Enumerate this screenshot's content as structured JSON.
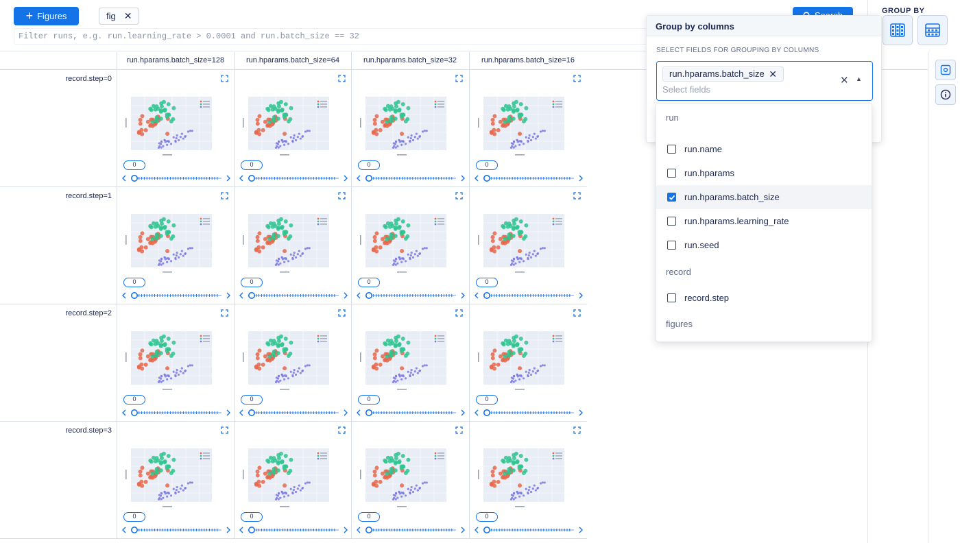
{
  "toolbar": {
    "figures_button": "Figures",
    "explore_chip": "fig",
    "search_button": "Search",
    "filter_placeholder": "Filter runs, e.g. run.learning_rate > 0.0001 and run.batch_size == 32"
  },
  "group_by": {
    "label": "GROUP BY"
  },
  "grid": {
    "columns": [
      "run.hparams.batch_size=128",
      "run.hparams.batch_size=64",
      "run.hparams.batch_size=32",
      "run.hparams.batch_size=16"
    ],
    "rows": [
      "record.step=0",
      "record.step=1",
      "record.step=2",
      "record.step=3"
    ],
    "step_value": "0"
  },
  "popup": {
    "title": "Group by columns",
    "subtitle": "SELECT FIELDS FOR GROUPING BY COLUMNS",
    "selected_chip": "run.hparams.batch_size",
    "placeholder": "Select fields",
    "groups": [
      {
        "name": "run",
        "items": [
          {
            "label": "run.name",
            "checked": false
          },
          {
            "label": "run.hparams",
            "checked": false
          },
          {
            "label": "run.hparams.batch_size",
            "checked": true
          },
          {
            "label": "run.hparams.learning_rate",
            "checked": false
          },
          {
            "label": "run.seed",
            "checked": false
          }
        ]
      },
      {
        "name": "record",
        "items": [
          {
            "label": "record.step",
            "checked": false
          }
        ]
      },
      {
        "name": "figures",
        "items": []
      }
    ]
  },
  "colors": {
    "accent": "#1473e6",
    "setosa": "#e8664a",
    "versicolor": "#2ec48f",
    "virginica": "#7b78e0",
    "plot_bg": "#e9edf5"
  }
}
